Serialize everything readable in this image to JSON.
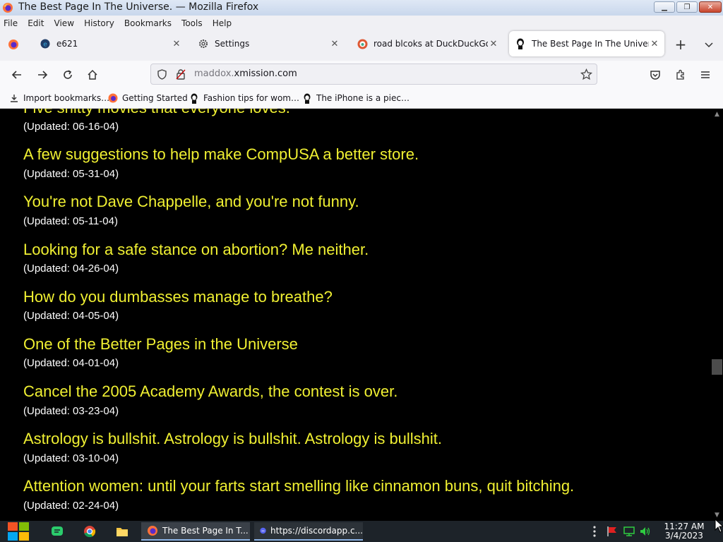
{
  "window": {
    "title": "The Best Page In The Universe. — Mozilla Firefox"
  },
  "menu": [
    "File",
    "Edit",
    "View",
    "History",
    "Bookmarks",
    "Tools",
    "Help"
  ],
  "tabs": [
    {
      "label": "e621",
      "active": false
    },
    {
      "label": "Settings",
      "active": false
    },
    {
      "label": "road blcoks at DuckDuckGo",
      "active": false
    },
    {
      "label": "The Best Page In The Universe.",
      "active": true
    }
  ],
  "urlbar": {
    "host_dim": "maddox.",
    "host": "xmission.com"
  },
  "bookmarks": [
    "Import bookmarks…",
    "Getting Started",
    "Fashion tips for wom…",
    "The iPhone is a piec…"
  ],
  "entries": [
    {
      "title": "Five shitty movies that everyone loves.",
      "date": "(Updated: 06-16-04)"
    },
    {
      "title": "A few suggestions to help make CompUSA a better store.",
      "date": "(Updated: 05-31-04)"
    },
    {
      "title": "You're not Dave Chappelle, and you're not funny.",
      "date": "(Updated: 05-11-04)"
    },
    {
      "title": "Looking for a safe stance on abortion? Me neither.",
      "date": "(Updated: 04-26-04)"
    },
    {
      "title": "How do you dumbasses manage to breathe?",
      "date": "(Updated: 04-05-04)"
    },
    {
      "title": "One of the Better Pages in the Universe",
      "date": "(Updated: 04-01-04)"
    },
    {
      "title": "Cancel the 2005 Academy Awards, the contest is over.",
      "date": "(Updated: 03-23-04)"
    },
    {
      "title": "Astrology is bullshit. Astrology is bullshit. Astrology is bullshit.",
      "date": "(Updated: 03-10-04)"
    },
    {
      "title": "Attention women: until your farts start smelling like cinnamon buns, quit bitching.",
      "date": "(Updated: 02-24-04)"
    }
  ],
  "taskbar": {
    "tasks": [
      "The Best Page In T...",
      "https://discordapp.c..."
    ],
    "clock_time": "11:27 AM",
    "clock_date": "3/4/2023"
  },
  "colors": {
    "link": "#f0f032",
    "page_bg": "#000000",
    "date_text": "#ffffff"
  }
}
